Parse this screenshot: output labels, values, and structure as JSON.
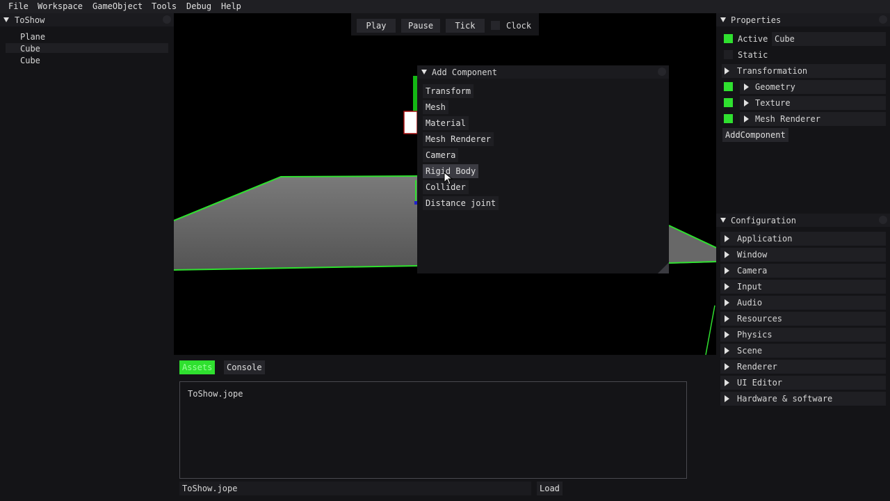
{
  "menubar": [
    "File",
    "Workspace",
    "GameObject",
    "Tools",
    "Debug",
    "Help"
  ],
  "hierarchy": {
    "title": "ToShow",
    "items": [
      "Plane",
      "Cube",
      "Cube"
    ]
  },
  "toolbar": {
    "play": "Play",
    "pause": "Pause",
    "tick": "Tick",
    "clock": "Clock"
  },
  "add_component": {
    "title": "Add Component",
    "items": [
      "Transform",
      "Mesh",
      "Material",
      "Mesh Renderer",
      "Camera",
      "Rigid Body",
      "Collider",
      "Distance joint"
    ],
    "hovered": "Rigid Body"
  },
  "properties": {
    "title": "Properties",
    "active_label": "Active",
    "active_checked": true,
    "name_value": "Cube",
    "static_label": "Static",
    "static_checked": false,
    "transformation": "Transformation",
    "components": [
      {
        "label": "Geometry",
        "enabled": true
      },
      {
        "label": "Texture",
        "enabled": true
      },
      {
        "label": "Mesh Renderer",
        "enabled": true
      }
    ],
    "add_button": "AddComponent"
  },
  "configuration": {
    "title": "Configuration",
    "items": [
      "Application",
      "Window",
      "Camera",
      "Input",
      "Audio",
      "Resources",
      "Physics",
      "Scene",
      "Renderer",
      "UI Editor",
      "Hardware & software"
    ]
  },
  "bottom": {
    "tabs": [
      {
        "label": "Assets",
        "active": true
      },
      {
        "label": "Console",
        "active": false
      }
    ],
    "files": [
      "ToShow.jope"
    ],
    "path_value": "ToShow.jope",
    "load_button": "Load"
  },
  "colors": {
    "accent_green": "#2fe02f",
    "panel_bg": "#141417",
    "button_bg": "#26262b",
    "viewport_bg": "#000000"
  }
}
